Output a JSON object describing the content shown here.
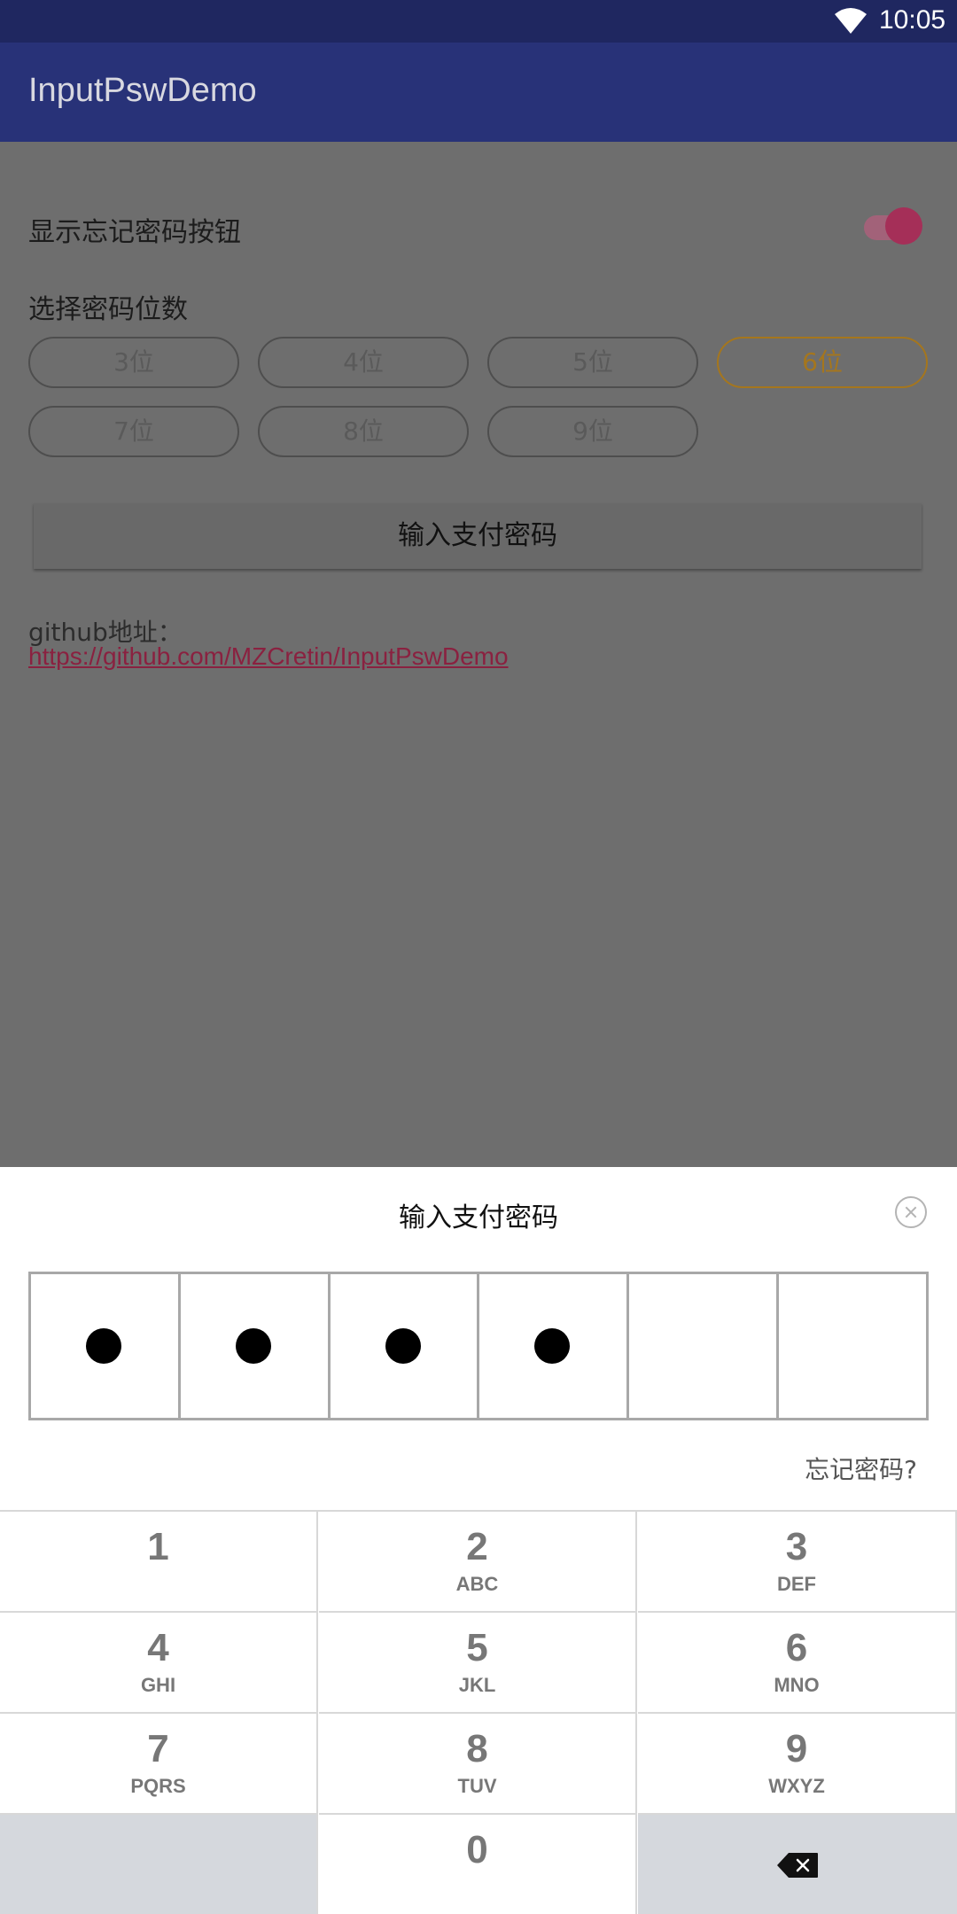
{
  "status_bar": {
    "time": "10:05",
    "wifi_icon": "wifi-icon"
  },
  "app_bar": {
    "title": "InputPswDemo"
  },
  "settings": {
    "show_forgot_label": "显示忘记密码按钮",
    "show_forgot_enabled": true,
    "digits_label": "选择密码位数",
    "digit_options": [
      "3位",
      "4位",
      "5位",
      "6位",
      "7位",
      "8位",
      "9位"
    ],
    "selected_option": "6位"
  },
  "pay_button_label": "输入支付密码",
  "github": {
    "label": "github地址：",
    "url": "https://github.com/MZCretin/InputPswDemo"
  },
  "sheet": {
    "title": "输入支付密码",
    "close_icon": "close-circle-icon",
    "password_length": 6,
    "entered_count": 4,
    "forgot_label": "忘记密码?"
  },
  "keypad": {
    "keys": [
      {
        "num": "1",
        "letters": ""
      },
      {
        "num": "2",
        "letters": "ABC"
      },
      {
        "num": "3",
        "letters": "DEF"
      },
      {
        "num": "4",
        "letters": "GHI"
      },
      {
        "num": "5",
        "letters": "JKL"
      },
      {
        "num": "6",
        "letters": "MNO"
      },
      {
        "num": "7",
        "letters": "PQRS"
      },
      {
        "num": "8",
        "letters": "TUV"
      },
      {
        "num": "9",
        "letters": "WXYZ"
      },
      {
        "num": "",
        "letters": ""
      },
      {
        "num": "0",
        "letters": ""
      }
    ],
    "delete_icon": "backspace-icon"
  },
  "colors": {
    "status_bar": "#1f2760",
    "app_bar": "#283278",
    "accent": "#a52f58",
    "selected_option": "#a5761d"
  }
}
